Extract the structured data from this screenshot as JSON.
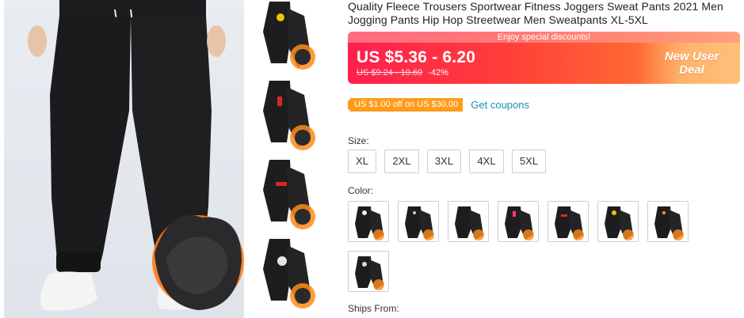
{
  "product": {
    "title": "Quality Fleece Trousers Sportwear Fitness Joggers Sweat Pants 2021 Men Jogging Pants Hip Hop Streetwear Men Sweatpants XL-5XL"
  },
  "price_box": {
    "promo_text": "Enjoy special discounts!",
    "price": "US $5.36 - 6.20",
    "original_price": "US $9.24 - 10.69",
    "discount": "-42%",
    "new_user_line1": "New User",
    "new_user_line2": "Deal",
    "colors": {
      "gradient_start": "#ff1f4f",
      "gradient_end": "#ff9a48"
    }
  },
  "coupon": {
    "tag": "US $1.00 off on US $30.00",
    "link": "Get coupons",
    "colors": {
      "tag": "#ff9b1a",
      "link": "#1a8fb5"
    }
  },
  "size": {
    "label": "Size:",
    "options": [
      "XL",
      "2XL",
      "3XL",
      "4XL",
      "5XL"
    ]
  },
  "color": {
    "label": "Color:",
    "swatches": [
      {
        "icon": "pants-logo-white"
      },
      {
        "icon": "pants-logo-small"
      },
      {
        "icon": "pants-plain"
      },
      {
        "icon": "pants-logo-red"
      },
      {
        "icon": "pants-logo-patch"
      },
      {
        "icon": "pants-logo-yellow"
      },
      {
        "icon": "pants-logo-orange"
      },
      {
        "icon": "pants-logo-print"
      }
    ]
  },
  "ships_from": {
    "label": "Ships From:"
  },
  "thumbnails": [
    {
      "icon": "pants-yellow-logo-icon"
    },
    {
      "icon": "pants-red-text-icon"
    },
    {
      "icon": "pants-red-patch-icon"
    },
    {
      "icon": "pants-white-print-icon"
    }
  ]
}
